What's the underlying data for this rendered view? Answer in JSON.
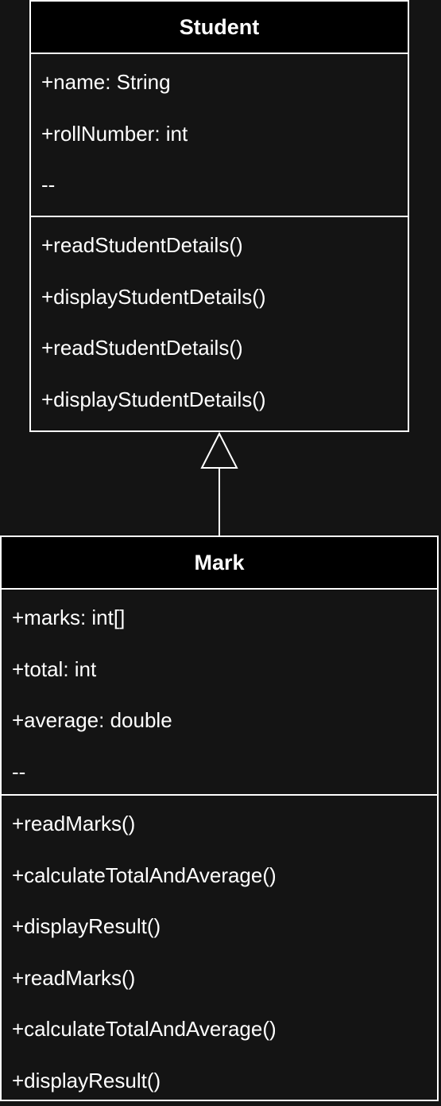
{
  "diagram": {
    "classes": [
      {
        "id": "student",
        "name": "Student",
        "attributes": [
          "+name: String",
          "+rollNumber: int",
          "--"
        ],
        "methods": [
          "+readStudentDetails()",
          "+displayStudentDetails()",
          "+readStudentDetails()",
          "+displayStudentDetails()"
        ]
      },
      {
        "id": "mark",
        "name": "Mark",
        "attributes": [
          "+marks: int[]",
          "+total: int",
          "+average: double",
          "--"
        ],
        "methods": [
          "+readMarks()",
          "+calculateTotalAndAverage()",
          "+displayResult()",
          "+readMarks()",
          "+calculateTotalAndAverage()",
          "+displayResult()"
        ]
      }
    ],
    "relationships": [
      {
        "type": "inheritance",
        "from": "mark",
        "to": "student"
      }
    ],
    "colors": {
      "background": "#141414",
      "header": "#000000",
      "line": "#ffffff",
      "text": "#ffffff"
    }
  }
}
